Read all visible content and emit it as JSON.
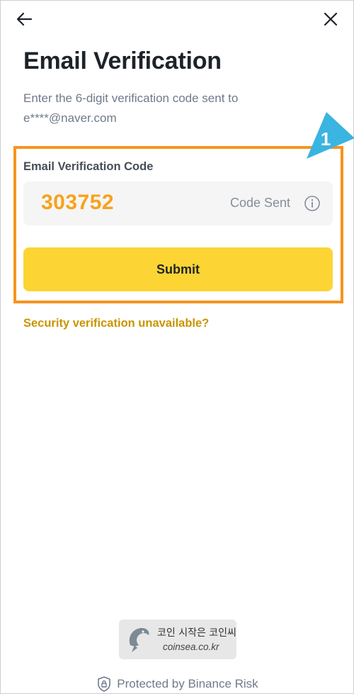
{
  "header": {
    "back_icon": "arrow-left-icon",
    "close_icon": "close-icon"
  },
  "page": {
    "title": "Email Verification",
    "description": "Enter the 6-digit verification code sent to e****@naver.com"
  },
  "form": {
    "label": "Email Verification Code",
    "code_value": "303752",
    "code_status": "Code Sent",
    "info_icon": "info-circle-icon",
    "submit_label": "Submit",
    "help_link": "Security verification unavailable?"
  },
  "annotation": {
    "step_number": "1"
  },
  "watermark": {
    "line1": "코인 시작은 코인씨",
    "line2": "coinsea.co.kr"
  },
  "footer": {
    "icon": "shield-lock-icon",
    "text": "Protected by Binance Risk"
  },
  "colors": {
    "brand_yellow": "#fcd535",
    "code_orange": "#f7a21b",
    "link_gold": "#c99400",
    "highlight_orange": "#f7941d",
    "marker_blue": "#3ab4e0"
  }
}
